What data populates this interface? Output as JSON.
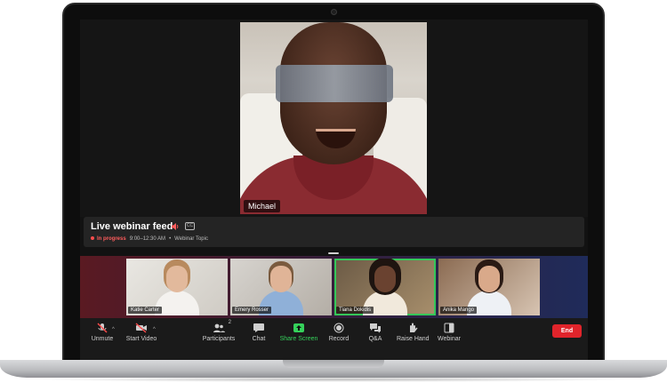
{
  "stage": {
    "speaker_name": "Michael"
  },
  "webinar": {
    "title": "Live webinar feed",
    "status_live": "In progress",
    "time": "9:00–12:30 AM",
    "topic": "Webinar Topic",
    "separator": "•"
  },
  "gallery": {
    "tiles": [
      {
        "name": "Katie Carter"
      },
      {
        "name": "Emery Rosser"
      },
      {
        "name": "Tiana Dokidis"
      },
      {
        "name": "Anika Mango"
      }
    ]
  },
  "toolbar": {
    "unmute": "Unmute",
    "start_video": "Start Video",
    "participants": "Participants",
    "participants_count": "2",
    "chat": "Chat",
    "share_screen": "Share Screen",
    "record": "Record",
    "qa": "Q&A",
    "raise_hand": "Raise Hand",
    "webinar": "Webinar",
    "end": "End",
    "caret": "^"
  },
  "colors": {
    "accent_green": "#35d15b",
    "end_red": "#e0242b",
    "live_red": "#ff5c5c"
  },
  "icons": {
    "unmute": "microphone-muted-icon",
    "start_video": "video-off-icon",
    "participants": "participants-icon",
    "chat": "chat-icon",
    "share_screen": "share-screen-icon",
    "record": "record-icon",
    "qa": "qa-icon",
    "raise_hand": "raise-hand-icon",
    "webinar": "webinar-icon",
    "volume": "speaker-volume-icon",
    "captions": "closed-captions-icon"
  }
}
